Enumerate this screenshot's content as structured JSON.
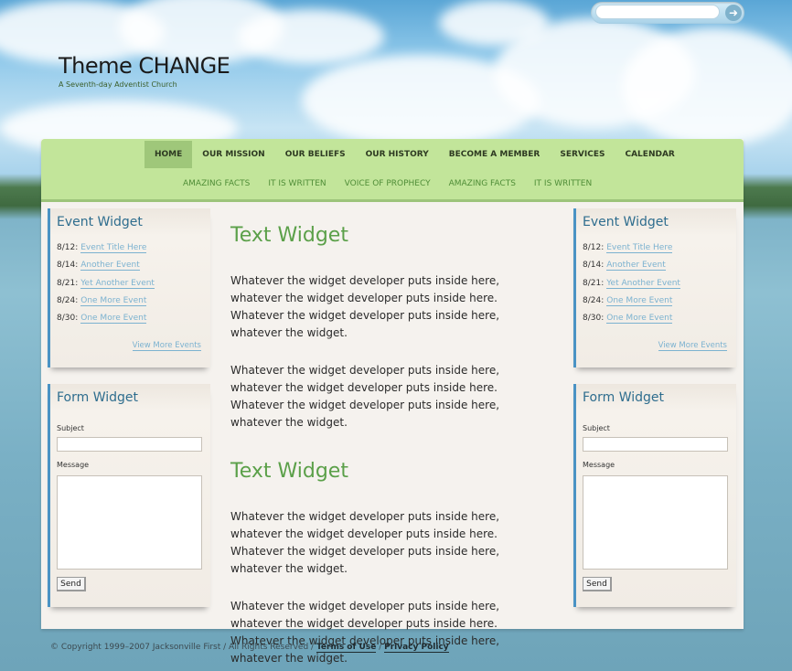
{
  "search": {
    "placeholder": "",
    "go_icon": "arrow-right-icon"
  },
  "site": {
    "title": "Theme CHANGE",
    "tagline": "A Seventh-day Adventist Church"
  },
  "nav": {
    "primary": [
      {
        "label": "HOME",
        "active": true
      },
      {
        "label": "OUR MISSION"
      },
      {
        "label": "OUR BELIEFS"
      },
      {
        "label": "OUR HISTORY"
      },
      {
        "label": "BECOME A MEMBER"
      },
      {
        "label": "SERVICES"
      },
      {
        "label": "CALENDAR"
      }
    ],
    "secondary": [
      {
        "label": "AMAZING FACTS"
      },
      {
        "label": "IT IS WRITTEN"
      },
      {
        "label": "VOICE OF PROPHECY"
      },
      {
        "label": "AMAZING FACTS"
      },
      {
        "label": "IT IS WRITTEN"
      }
    ]
  },
  "event_widget": {
    "title": "Event Widget",
    "events": [
      {
        "date": "8/12:",
        "title": "Event Title Here"
      },
      {
        "date": "8/14:",
        "title": "Another Event"
      },
      {
        "date": "8/21:",
        "title": "Yet Another Event"
      },
      {
        "date": "8/24:",
        "title": "One More Event"
      },
      {
        "date": "8/30:",
        "title": "One More Event"
      }
    ],
    "more_link": "View More Events"
  },
  "form_widget": {
    "title": "Form Widget",
    "subject_label": "Subject",
    "message_label": "Message",
    "send_label": "Send"
  },
  "main": {
    "sections": [
      {
        "heading": "Text Widget",
        "paragraphs": [
          "Whatever the widget developer puts inside here, whatever the widget developer puts inside here. Whatever the widget developer puts inside here, whatever the widget.",
          "Whatever the widget developer puts inside here, whatever the widget developer puts inside here. Whatever the widget developer puts inside here, whatever the widget."
        ]
      },
      {
        "heading": "Text Widget",
        "paragraphs": [
          "Whatever the widget developer puts inside here, whatever the widget developer puts inside here. Whatever the widget developer puts inside here, whatever the widget.",
          "Whatever the widget developer puts inside here, whatever the widget developer puts inside here. Whatever the widget developer puts inside here, whatever the widget."
        ]
      }
    ]
  },
  "footer": {
    "copyright": "© Copyright 1999–2007 Jacksonville First / All Rights Reserved /",
    "separator": "/",
    "terms": "Terms of Use",
    "privacy": "Privacy Policy"
  },
  "colors": {
    "nav_bg": "#c2e59a",
    "nav_active": "#9fc77a",
    "heading_green": "#5ba049",
    "widget_title": "#2e6d8e",
    "link_blue": "#7cb2d0",
    "widget_accent": "#4a93c4"
  }
}
